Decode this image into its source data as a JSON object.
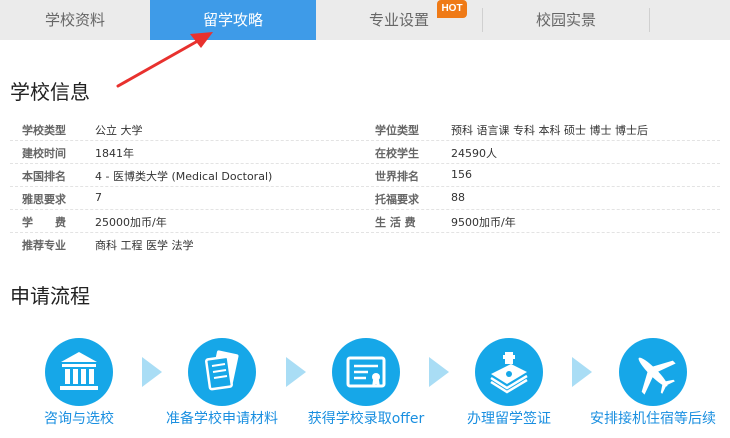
{
  "tabs": [
    {
      "label": "学校资料"
    },
    {
      "label": "留学攻略"
    },
    {
      "label": "专业设置"
    },
    {
      "label": "校园实景"
    }
  ],
  "hot_badge": "HOT",
  "school_info": {
    "title": "学校信息",
    "rows": [
      {
        "l1": "学校类型",
        "v1": "公立 大学",
        "l2": "学位类型",
        "v2": "预科 语言课 专科 本科 硕士 博士 博士后"
      },
      {
        "l1": "建校时间",
        "v1": "1841年",
        "l2": "在校学生",
        "v2": "24590人"
      },
      {
        "l1": "本国排名",
        "v1": "4 - 医博类大学 (Medical Doctoral)",
        "l2": "世界排名",
        "v2": "156"
      },
      {
        "l1": "雅思要求",
        "v1": "7",
        "l2": "托福要求",
        "v2": "88"
      },
      {
        "l1": "学　　费",
        "v1": "25000加币/年",
        "l2": "生 活 费",
        "v2": "9500加币/年"
      },
      {
        "l1": "推荐专业",
        "v1": "商科 工程 医学 法学",
        "l2": "",
        "v2": ""
      }
    ]
  },
  "process": {
    "title": "申请流程",
    "steps": [
      {
        "label": "咨询与选校",
        "icon": "building-icon"
      },
      {
        "label": "准备学校申请材料",
        "icon": "documents-icon"
      },
      {
        "label": "获得学校录取offer",
        "icon": "certificate-icon"
      },
      {
        "label": "办理留学签证",
        "icon": "passport-icon"
      },
      {
        "label": "安排接机住宿等后续",
        "icon": "airplane-icon"
      }
    ]
  }
}
